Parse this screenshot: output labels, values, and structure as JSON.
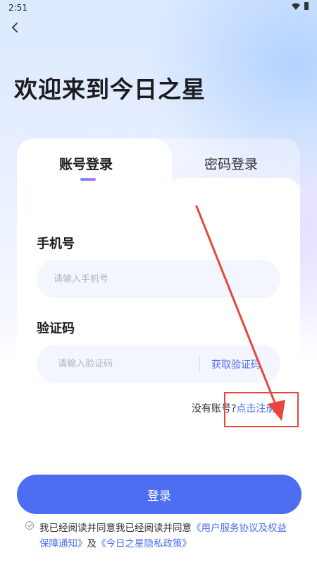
{
  "status_bar": {
    "time": "2:51"
  },
  "header": {
    "title": "欢迎来到今日之星"
  },
  "tabs": [
    {
      "label": "账号登录",
      "active": true
    },
    {
      "label": "密码登录",
      "active": false
    }
  ],
  "form": {
    "phone_label": "手机号",
    "phone_placeholder": "请输入手机号",
    "code_label": "验证码",
    "code_placeholder": "请输入验证码",
    "get_code_label": "获取验证码"
  },
  "register": {
    "prompt": "没有账号?",
    "link": "点击注册"
  },
  "login_button": "登录",
  "agreement": {
    "prefix": "我已经阅读并同意我已经阅读并同意",
    "terms": "《用户服务协议及权益保障通知》",
    "connector": "及",
    "privacy": "《今日之星隐私政策》"
  },
  "colors": {
    "accent": "#4e6ef2",
    "annotation": "#e8463a"
  }
}
